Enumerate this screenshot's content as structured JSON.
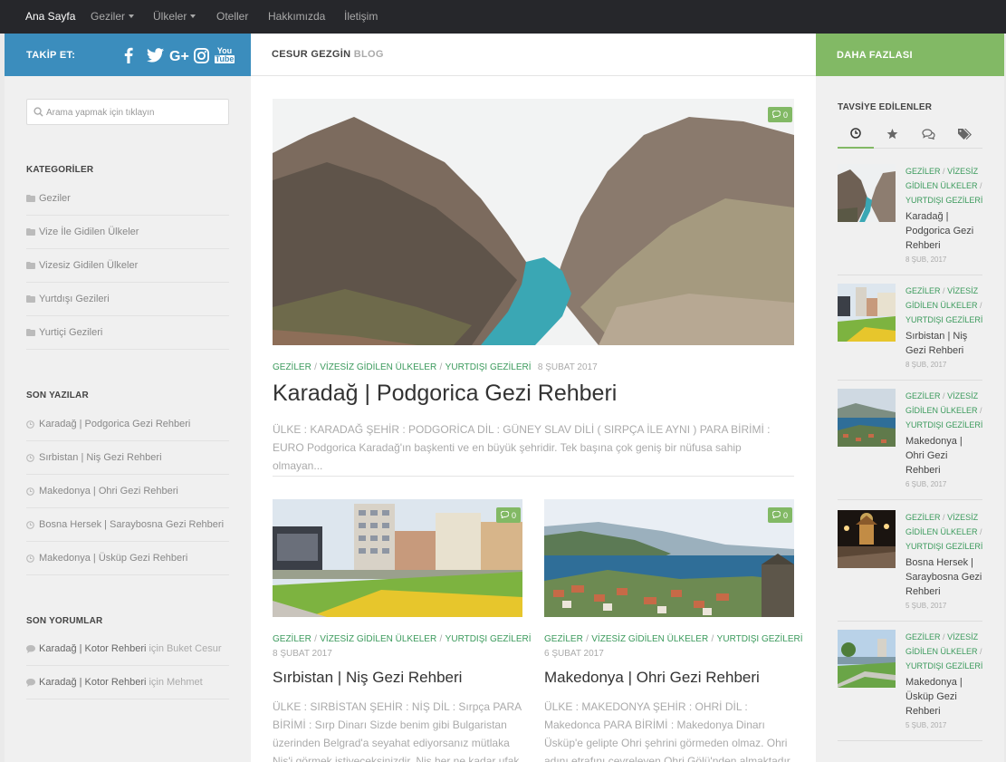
{
  "nav": {
    "items": [
      {
        "label": "Ana Sayfa",
        "active": true,
        "dropdown": false
      },
      {
        "label": "Geziler",
        "active": false,
        "dropdown": true
      },
      {
        "label": "Ülkeler",
        "active": false,
        "dropdown": true
      },
      {
        "label": "Oteller",
        "active": false,
        "dropdown": false
      },
      {
        "label": "Hakkımızda",
        "active": false,
        "dropdown": false
      },
      {
        "label": "İletişim",
        "active": false,
        "dropdown": false
      }
    ]
  },
  "follow": {
    "label": "TAKİP ET:",
    "icons": [
      "facebook-icon",
      "twitter-icon",
      "google-plus-icon",
      "instagram-icon",
      "youtube-icon"
    ],
    "youtube_text": [
      "You",
      "Tube"
    ]
  },
  "blog": {
    "title": "CESUR GEZGİN",
    "subtitle": "BLOG"
  },
  "more": {
    "label": "DAHA FAZLASI"
  },
  "search": {
    "placeholder": "Arama yapmak için tıklayın"
  },
  "categories": {
    "title": "KATEGORİLER",
    "items": [
      "Geziler",
      "Vize İle Gidilen Ülkeler",
      "Vizesiz Gidilen Ülkeler",
      "Yurtdışı Gezileri",
      "Yurtiçi Gezileri"
    ]
  },
  "recent_posts": {
    "title": "SON YAZILAR",
    "items": [
      "Karadağ | Podgorica Gezi Rehberi",
      "Sırbistan | Niş Gezi Rehberi",
      "Makedonya | Ohri Gezi Rehberi",
      "Bosna Hersek | Saraybosna Gezi Rehberi",
      "Makedonya | Üsküp Gezi Rehberi"
    ]
  },
  "recent_comments": {
    "title": "SON YORUMLAR",
    "items": [
      {
        "post": "Karadağ | Kotor Rehberi",
        "connector": "için",
        "author": "Buket Cesur"
      },
      {
        "post": "Karadağ | Kotor Rehberi",
        "connector": "için",
        "author": "Mehmet"
      }
    ]
  },
  "featured": {
    "comment_count": "0",
    "categories": [
      "GEZİLER",
      "VİZESİZ GİDİLEN ÜLKELER",
      "YURTDIŞI GEZİLERİ"
    ],
    "date": "8 ŞUBAT 2017",
    "title": "Karadağ | Podgorica Gezi Rehberi",
    "excerpt": "ÜLKE : KARADAĞ ŞEHİR : PODGORİCA DİL : GÜNEY SLAV DİLİ ( SIRPÇA İLE AYNI ) PARA BİRİMİ : EURO Podgorica Karadağ'ın başkenti ve en büyük şehridir. Tek başına çok geniş bir nüfusa sahip olmayan..."
  },
  "posts": [
    {
      "comment_count": "0",
      "categories": [
        "GEZİLER",
        "VİZESİZ GİDİLEN ÜLKELER",
        "YURTDIŞI GEZİLERİ"
      ],
      "date": "8 ŞUBAT 2017",
      "title": "Sırbistan | Niş Gezi Rehberi",
      "excerpt": "ÜLKE : SIRBİSTAN ŞEHİR : NİŞ DİL : Sırpça PARA BİRİMİ : Sırp Dinarı Sizde benim gibi Bulgaristan üzerinden Belgrad'a seyahat ediyorsanız mütlaka Niş'i görmek istiyeceksinizdir. Niş her ne kadar ufak bir şehirde"
    },
    {
      "comment_count": "0",
      "categories": [
        "GEZİLER",
        "VİZESİZ GİDİLEN ÜLKELER",
        "YURTDIŞI GEZİLERİ"
      ],
      "date": "6 ŞUBAT 2017",
      "title": "Makedonya | Ohri Gezi Rehberi",
      "excerpt": "ÜLKE : MAKEDONYA ŞEHİR : OHRİ DİL : Makedonca PARA BİRİMİ : Makedonya Dinarı Üsküp'e gelipte Ohri şehrini görmeden olmaz. Ohri adını etrafını çevreleyen Ohri Gölü'nden almaktadır. Bu gölün karşı"
    }
  ],
  "recommended": {
    "title": "TAVSİYE EDİLENLER",
    "tabs": [
      "clock-icon",
      "star-icon",
      "comments-icon",
      "tags-icon"
    ],
    "items": [
      {
        "categories": [
          "GEZİLER",
          "VİZESİZ GİDİLEN ÜLKELER",
          "YURTDIŞI GEZİLERİ"
        ],
        "title": "Karadağ | Podgorica Gezi Rehberi",
        "date": "8 ŞUB, 2017"
      },
      {
        "categories": [
          "GEZİLER",
          "VİZESİZ GİDİLEN ÜLKELER",
          "YURTDIŞI GEZİLERİ"
        ],
        "title": "Sırbistan | Niş Gezi Rehberi",
        "date": "8 ŞUB, 2017"
      },
      {
        "categories": [
          "GEZİLER",
          "VİZESİZ GİDİLEN ÜLKELER",
          "YURTDIŞI GEZİLERİ"
        ],
        "title": "Makedonya | Ohri Gezi Rehberi",
        "date": "6 ŞUB, 2017"
      },
      {
        "categories": [
          "GEZİLER",
          "VİZESİZ GİDİLEN ÜLKELER",
          "YURTDIŞI GEZİLERİ"
        ],
        "title": "Bosna Hersek | Saraybosna Gezi Rehberi",
        "date": "5 ŞUB, 2017"
      },
      {
        "categories": [
          "GEZİLER",
          "VİZESİZ GİDİLEN ÜLKELER",
          "YURTDIŞI GEZİLERİ"
        ],
        "title": "Makedonya | Üsküp Gezi Rehberi",
        "date": "5 ŞUB, 2017"
      }
    ]
  },
  "colors": {
    "nav_bg": "#26272b",
    "follow_bg": "#3b8dbd",
    "more_bg": "#82b965",
    "category_link": "#3b9a5c"
  }
}
